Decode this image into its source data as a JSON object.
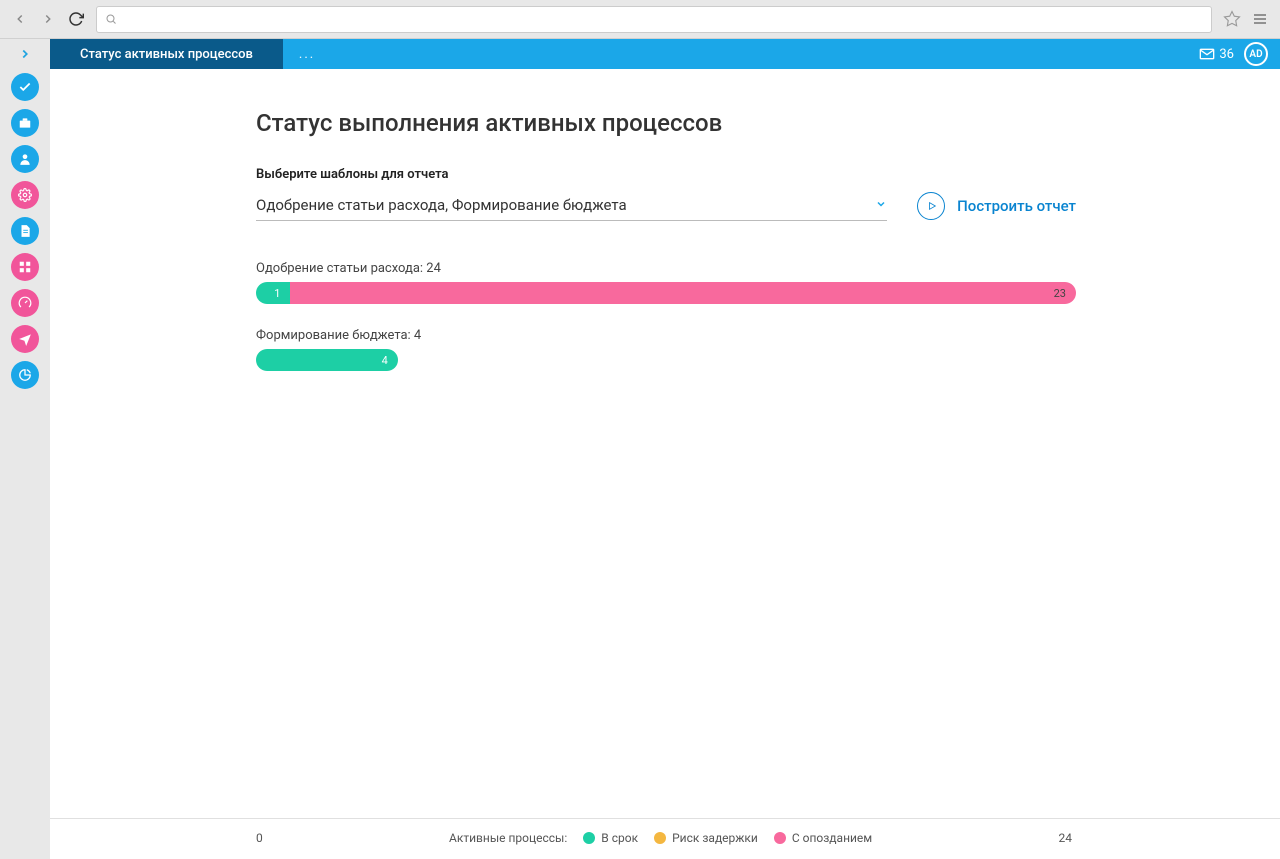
{
  "header": {
    "tab_title": "Статус активных процессов",
    "more": "...",
    "mail_count": "36",
    "avatar": "AD"
  },
  "main": {
    "title": "Статус выполнения активных процессов",
    "select_label": "Выберите шаблоны для отчета",
    "select_value": "Одобрение статьи расхода, Формирование бюджета",
    "build_btn": "Построить отчет"
  },
  "processes": [
    {
      "label": "Одобрение статьи расхода: 24",
      "segments": [
        {
          "cls": "g",
          "value": "1",
          "pct": 4.2
        },
        {
          "cls": "p",
          "value": "23",
          "pct": 95.8
        }
      ],
      "width_pct": 100
    },
    {
      "label": "Формирование бюджета: 4",
      "segments": [
        {
          "cls": "g",
          "value": "4",
          "pct": 100
        }
      ],
      "width_pct": 17.3
    }
  ],
  "footer": {
    "axis_min": "0",
    "axis_max": "24",
    "legend_title": "Активные процессы:",
    "legend": [
      {
        "cls": "g",
        "label": "В срок"
      },
      {
        "cls": "o",
        "label": "Риск задержки"
      },
      {
        "cls": "p",
        "label": "С опозданием"
      }
    ]
  },
  "chart_data": {
    "type": "bar",
    "title": "Статус выполнения активных процессов",
    "xlabel": "Активные процессы",
    "ylabel": "",
    "xlim": [
      0,
      24
    ],
    "categories": [
      "Одобрение статьи расхода",
      "Формирование бюджета"
    ],
    "series": [
      {
        "name": "В срок",
        "values": [
          1,
          4
        ]
      },
      {
        "name": "Риск задержки",
        "values": [
          0,
          0
        ]
      },
      {
        "name": "С опозданием",
        "values": [
          23,
          0
        ]
      }
    ]
  }
}
